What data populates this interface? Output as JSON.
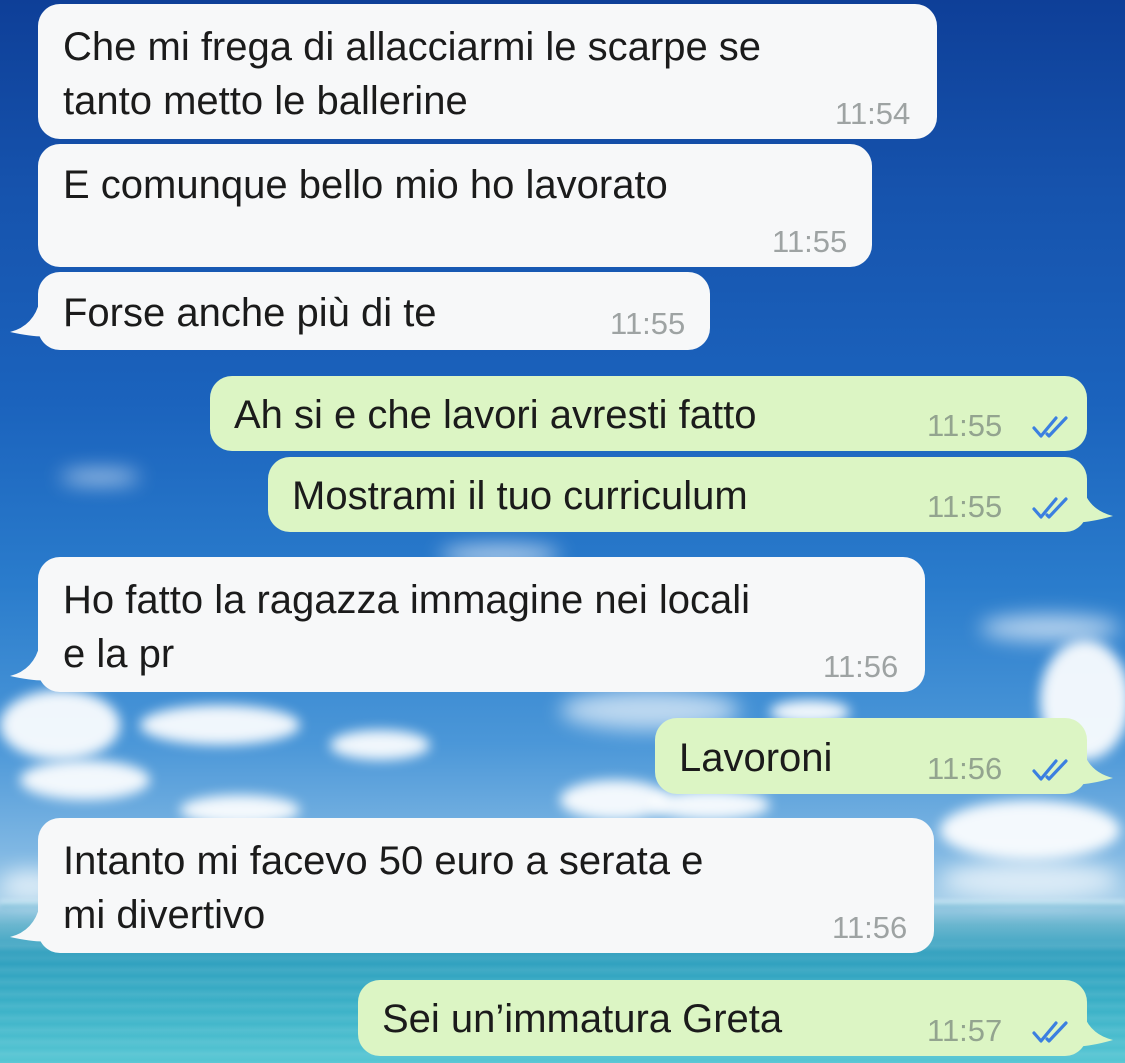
{
  "messages": [
    {
      "direction": "incoming",
      "text": "Che mi frega di allacciarmi le scarpe se\ntanto metto le ballerine",
      "time": "11:54"
    },
    {
      "direction": "incoming",
      "text": "E comunque bello mio ho lavorato",
      "time": "11:55"
    },
    {
      "direction": "incoming",
      "text": "Forse anche più di te",
      "time": "11:55"
    },
    {
      "direction": "outgoing",
      "text": "Ah si e che lavori avresti fatto",
      "time": "11:55",
      "status": "read",
      "status_icon": "double-check-icon"
    },
    {
      "direction": "outgoing",
      "text": "Mostrami il tuo curriculum",
      "time": "11:55",
      "status": "read",
      "status_icon": "double-check-icon"
    },
    {
      "direction": "incoming",
      "text": "Ho fatto la ragazza immagine nei locali\ne la pr",
      "time": "11:56"
    },
    {
      "direction": "outgoing",
      "text": "Lavoroni",
      "time": "11:56",
      "status": "read",
      "status_icon": "double-check-icon"
    },
    {
      "direction": "incoming",
      "text": "Intanto mi facevo 50 euro a serata e\nmi divertivo",
      "time": "11:56"
    },
    {
      "direction": "outgoing",
      "text": "Sei un’immatura Greta",
      "time": "11:57",
      "status": "read",
      "status_icon": "double-check-icon"
    }
  ],
  "colors": {
    "incoming_bubble": "#f7f8f9",
    "outgoing_bubble": "#dcf5c4",
    "read_ticks": "#3b7fe0",
    "timestamp": "#9ea3a3"
  },
  "wallpaper": "sky-and-sea"
}
